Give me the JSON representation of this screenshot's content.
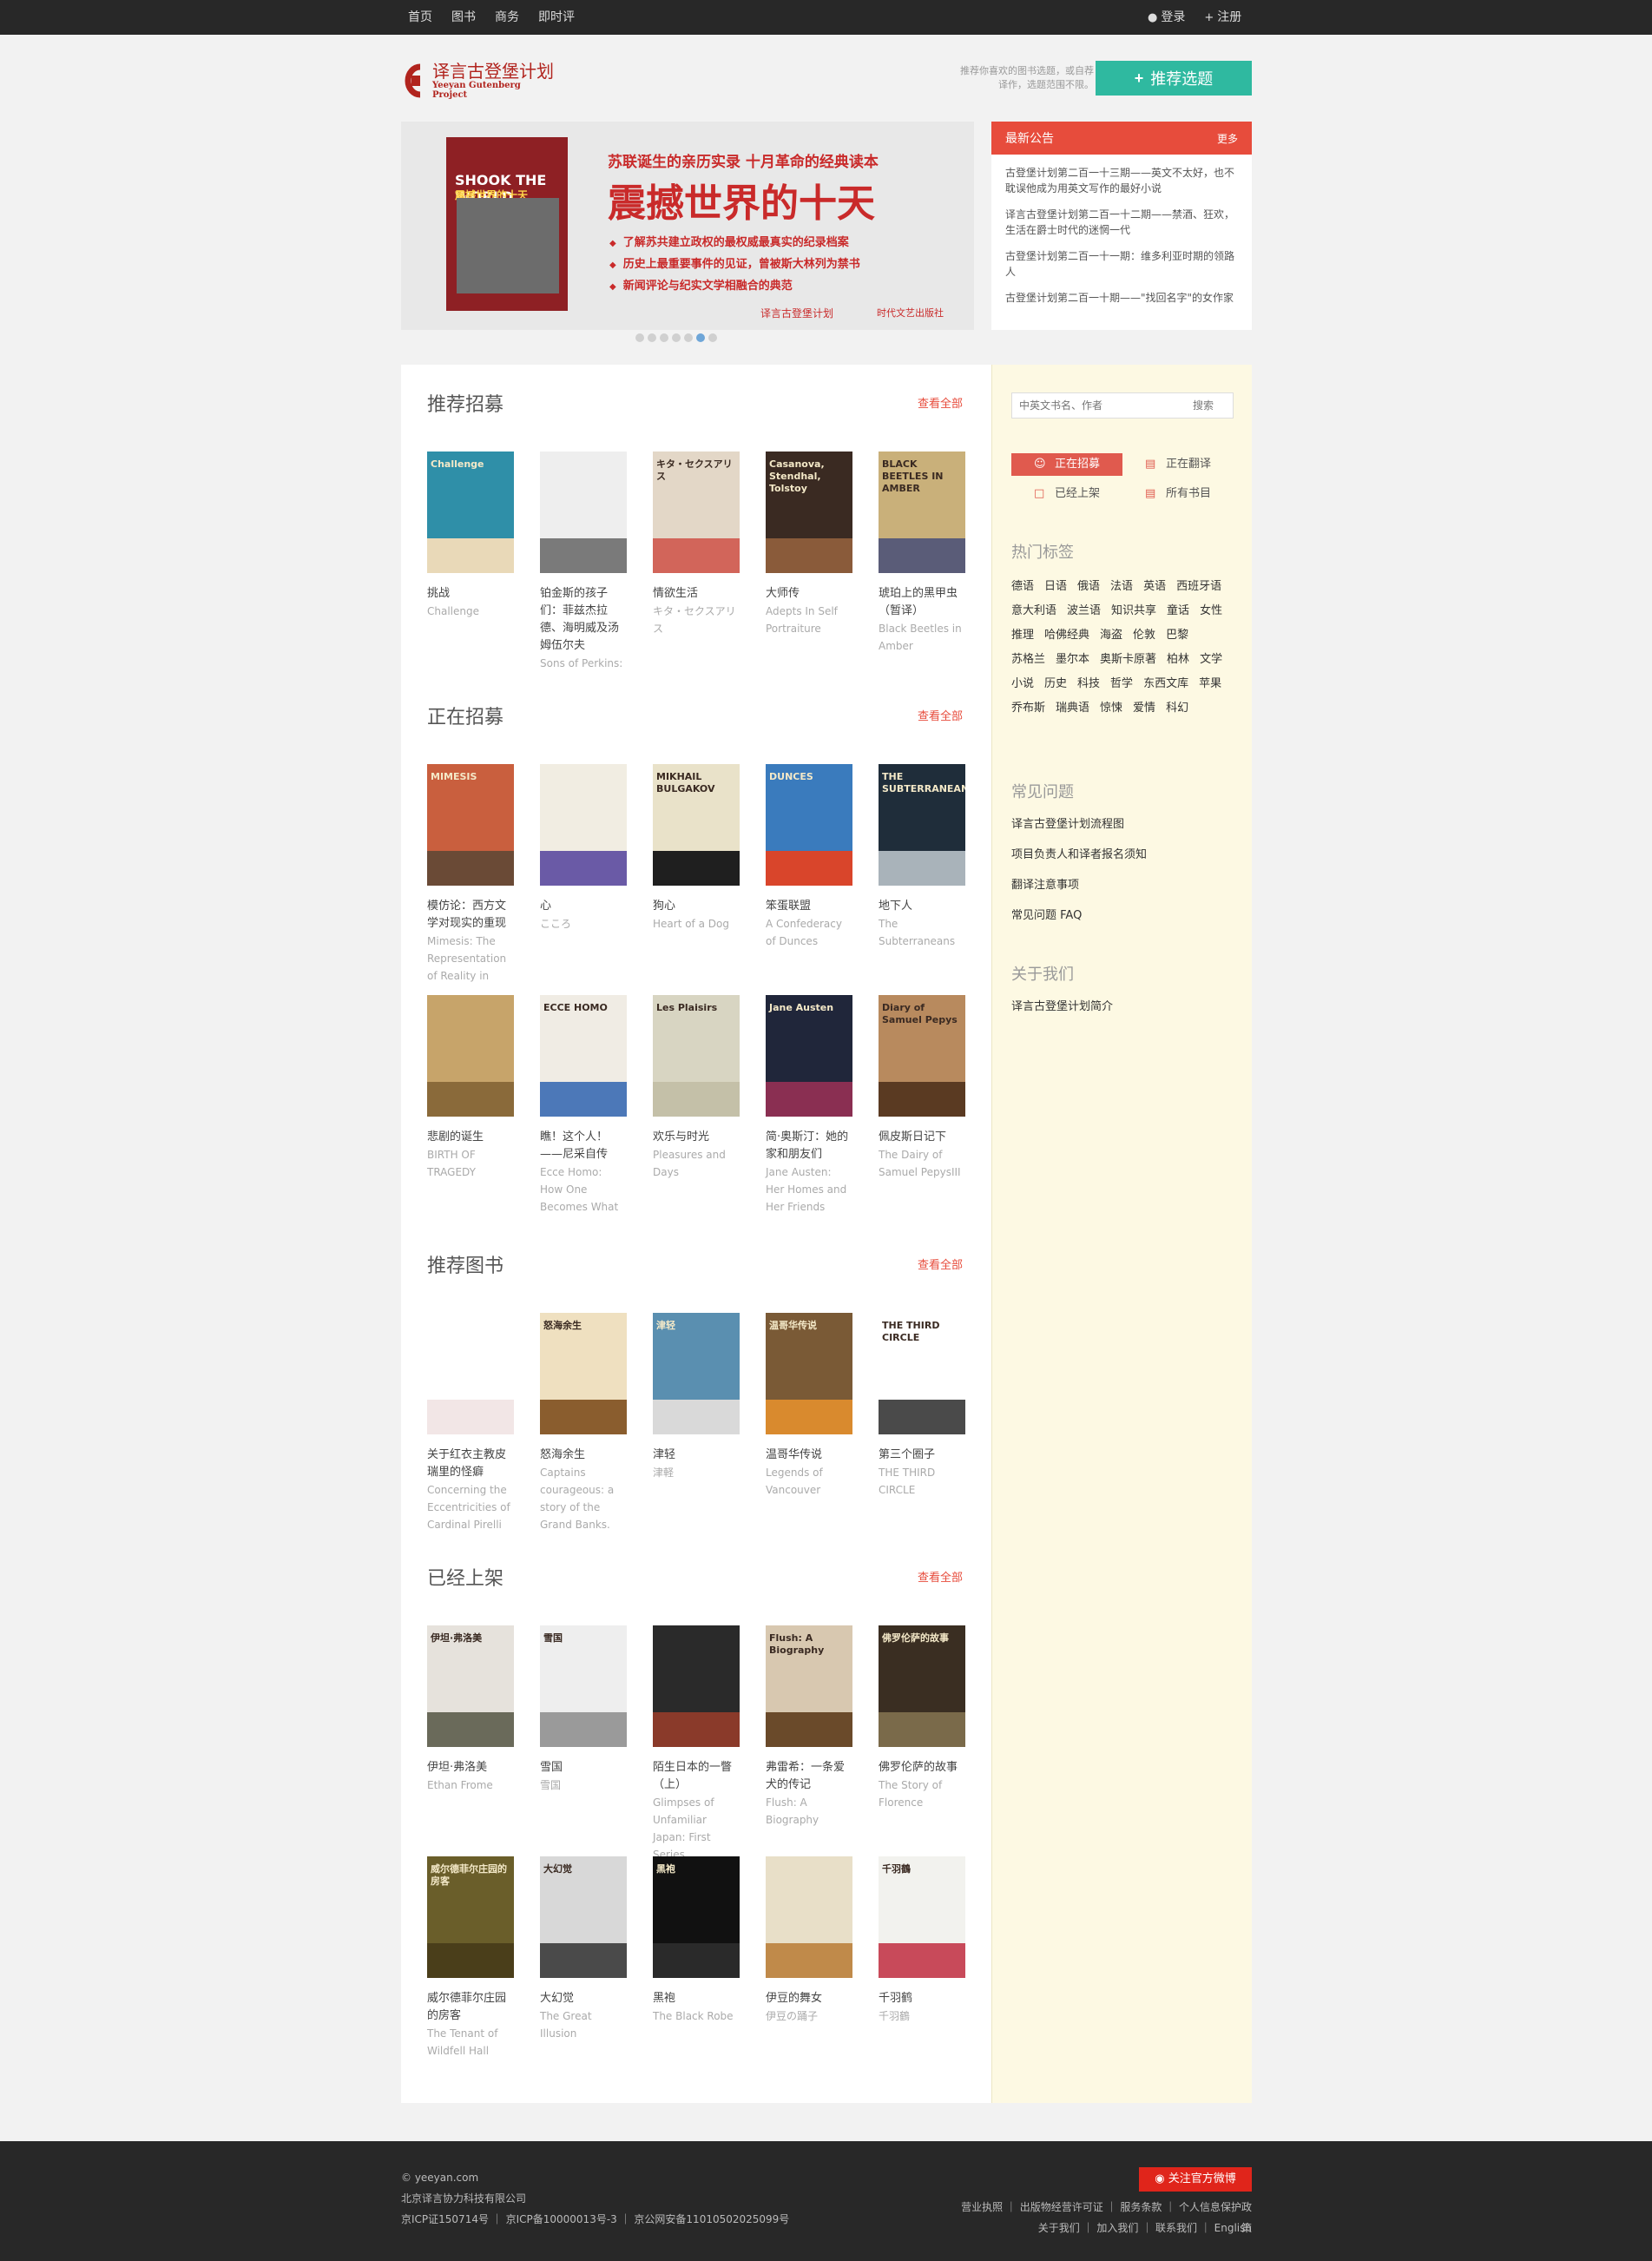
{
  "topnav": {
    "items": [
      "首页",
      "图书",
      "商务",
      "即时评"
    ]
  },
  "auth": {
    "login": "登录",
    "register": "注册"
  },
  "brand": {
    "name_cn": "译言古登堡计划",
    "name_en": "Yeeyan Gutenberg Project"
  },
  "header": {
    "note": "推荐你喜欢的图书选题，或自荐译作，选题范围不限。",
    "recommend_button": "推荐选题"
  },
  "banner": {
    "book_title_en": "SHOOK THE WORLD",
    "book_title_cn": "震撼世界的十天",
    "subtitle": "苏联诞生的亲历实录 十月革命的经典读本",
    "title": "震撼世界的十天",
    "bullets": [
      "了解苏共建立政权的最权威最真实的纪录档案",
      "历史上最重要事件的见证，曾被斯大林列为禁书",
      "新闻评论与纪实文学相融合的典范"
    ],
    "publisher1": "译言古登堡计划",
    "publisher2": "时代文艺出版社",
    "slides": 7,
    "active_slide": 6
  },
  "notice": {
    "title": "最新公告",
    "more": "更多",
    "items": [
      "古登堡计划第二百一十三期——英文不太好，也不耽误他成为用英文写作的最好小说",
      "译言古登堡计划第二百一十二期——禁酒、狂欢，生活在爵士时代的迷惘一代",
      "古登堡计划第二百一十一期：维多利亚时期的领路人",
      "古登堡计划第二百一十期——\"找回名字\"的女作家"
    ]
  },
  "sections": [
    {
      "title": "推荐招募",
      "more": "查看全部",
      "books": [
        {
          "cn": "挑战",
          "en": "Challenge",
          "color": "#2f8fa8",
          "band": "#e9d9b8",
          "label": "Challenge"
        },
        {
          "cn": "铂金斯的孩子们：菲兹杰拉德、海明威及汤姆伍尔夫",
          "en": "Sons of Perkins:",
          "color": "#eeeeee",
          "band": "#7a7a7a",
          "label": ""
        },
        {
          "cn": "情欲生活",
          "en": "キタ・セクスアリス",
          "color": "#e3d7c7",
          "band": "#d2655a",
          "label": "キタ・セクスアリス"
        },
        {
          "cn": "大师传",
          "en": "Adepts In Self Portraiture",
          "color": "#3a2a22",
          "band": "#8a5b3a",
          "label": "Casanova, Stendhal, Tolstoy"
        },
        {
          "cn": "琥珀上的黑甲虫（暂译）",
          "en": "Black Beetles in Amber",
          "color": "#c9b07a",
          "band": "#5a5c78",
          "label": "BLACK BEETLES IN AMBER"
        }
      ]
    },
    {
      "title": "正在招募",
      "more": "查看全部",
      "books": [
        {
          "cn": "模仿论：西方文学对现实的重现",
          "en": "Mimesis: The Representation of Reality in",
          "color": "#c95f3e",
          "band": "#6a4a36",
          "label": "MIMESIS"
        },
        {
          "cn": "心",
          "en": "こころ",
          "color": "#f1ede2",
          "band": "#6a5aa6",
          "label": ""
        },
        {
          "cn": "狗心",
          "en": "Heart of a Dog",
          "color": "#e9e2c9",
          "band": "#1f1f1f",
          "label": "MIKHAIL BULGAKOV"
        },
        {
          "cn": "笨蛋联盟",
          "en": "A Confederacy of Dunces",
          "color": "#3a7bbd",
          "band": "#d9452b",
          "label": "DUNCES"
        },
        {
          "cn": "地下人",
          "en": "The Subterraneans",
          "color": "#1f2d3a",
          "band": "#a9b3ba",
          "label": "THE SUBTERRANEANS"
        },
        {
          "cn": "悲剧的诞生",
          "en": "BIRTH OF TRAGEDY",
          "color": "#c7a46a",
          "band": "#8a6a3a",
          "label": ""
        },
        {
          "cn": "瞧！这个人！——尼采自传",
          "en": "Ecce Homo: How One Becomes What",
          "color": "#f0ece4",
          "band": "#4c78b8",
          "label": "ECCE HOMO"
        },
        {
          "cn": "欢乐与时光",
          "en": "Pleasures and Days",
          "color": "#d8d5c2",
          "band": "#c4c0a8",
          "label": "Les Plaisirs"
        },
        {
          "cn": "简·奥斯汀：她的家和朋友们",
          "en": "Jane Austen: Her Homes and Her Friends",
          "color": "#20263a",
          "band": "#8a2f52",
          "label": "Jane Austen"
        },
        {
          "cn": "佩皮斯日记下",
          "en": "The Dairy of Samuel PepysIII",
          "color": "#b88a5e",
          "band": "#5a3a22",
          "label": "Diary of Samuel Pepys"
        }
      ]
    },
    {
      "title": "推荐图书",
      "more": "查看全部",
      "books": [
        {
          "cn": "关于红衣主教皮瑞里的怪癖",
          "en": "Concerning the Eccentricities of Cardinal Pirelli",
          "color": "#ffffff",
          "band": "#f2e6e6",
          "label": ""
        },
        {
          "cn": "怒海余生",
          "en": "Captains courageous: a story of the Grand Banks.",
          "color": "#efe0c0",
          "band": "#8a5d2e",
          "label": "怒海余生"
        },
        {
          "cn": "津轻",
          "en": "津軽",
          "color": "#5a8fb0",
          "band": "#d9d9d9",
          "label": "津轻"
        },
        {
          "cn": "温哥华传说",
          "en": "Legends of Vancouver",
          "color": "#7a5a36",
          "band": "#d98a2e",
          "label": "温哥华传说"
        },
        {
          "cn": "第三个圈子",
          "en": "THE THIRD CIRCLE",
          "color": "#ffffff",
          "band": "#4a4a4a",
          "label": "THE THIRD CIRCLE"
        }
      ]
    },
    {
      "title": "已经上架",
      "more": "查看全部",
      "books": [
        {
          "cn": "伊坦·弗洛美",
          "en": "Ethan Frome",
          "color": "#e6e2dc",
          "band": "#6a6a5a",
          "label": "伊坦·弗洛美"
        },
        {
          "cn": "雪国",
          "en": "雪国",
          "color": "#eeeeee",
          "band": "#9a9a9a",
          "label": "雪国"
        },
        {
          "cn": "陌生日本的一瞥（上）",
          "en": "Glimpses of Unfamiliar Japan: First Series",
          "color": "#2a2a2a",
          "band": "#8a3a2a",
          "label": ""
        },
        {
          "cn": "弗雷希：一条爱犬的传记",
          "en": "Flush: A Biography",
          "color": "#d8c8b0",
          "band": "#6a4a2a",
          "label": "Flush: A Biography"
        },
        {
          "cn": "佛罗伦萨的故事",
          "en": "The Story of Florence",
          "color": "#3a2e22",
          "band": "#7a6a4a",
          "label": "佛罗伦萨的故事"
        },
        {
          "cn": "威尔德菲尔庄园的房客",
          "en": "The Tenant of Wildfell Hall",
          "color": "#6a5e2a",
          "band": "#4a3e1a",
          "label": "威尔德菲尔庄园的房客"
        },
        {
          "cn": "大幻觉",
          "en": "The Great Illusion",
          "color": "#d8d8d8",
          "band": "#4a4a4a",
          "label": "大幻觉"
        },
        {
          "cn": "黑袍",
          "en": "The Black Robe",
          "color": "#111111",
          "band": "#2a2a2a",
          "label": "黑袍"
        },
        {
          "cn": "伊豆的舞女",
          "en": "伊豆の踊子",
          "color": "#e8dfc8",
          "band": "#c08a4a",
          "label": ""
        },
        {
          "cn": "千羽鹤",
          "en": "千羽鶴",
          "color": "#f2f2ee",
          "band": "#c84a5a",
          "label": "千羽鶴"
        }
      ]
    }
  ],
  "sidebar": {
    "search_placeholder": "中英文书名、作者",
    "search_button": "搜索",
    "status": [
      "正在招募",
      "正在翻译",
      "已经上架",
      "所有书目"
    ],
    "tags_title": "热门标签",
    "tags": [
      "德语",
      "日语",
      "俄语",
      "法语",
      "英语",
      "西班牙语",
      "意大利语",
      "波兰语",
      "知识共享",
      "童话",
      "女性",
      "推理",
      "哈佛经典",
      "海盗",
      "伦敦",
      "巴黎",
      "苏格兰",
      "墨尔本",
      "奥斯卡原著",
      "柏林",
      "文学",
      "小说",
      "历史",
      "科技",
      "哲学",
      "东西文库",
      "苹果",
      "乔布斯",
      "瑞典语",
      "惊悚",
      "爱情",
      "科幻"
    ],
    "faq_title": "常见问题",
    "faq": [
      "译言古登堡计划流程图",
      "项目负责人和译者报名须知",
      "翻译注意事项",
      "常见问题 FAQ"
    ],
    "about_title": "关于我们",
    "about": [
      "译言古登堡计划简介"
    ]
  },
  "footer": {
    "copyright": "© yeeyan.com",
    "company": "北京译言协力科技有限公司",
    "icp": "京ICP证150714号 ｜ 京ICP备10000013号-3 ｜ 京公网安备11010502025099号",
    "weibo": "关注官方微博",
    "links1": "营业执照 ｜ 出版物经营许可证 ｜ 服务条款 ｜ 个人信息保护政策",
    "links2": "关于我们 ｜ 加入我们 ｜ 联系我们 ｜ English"
  },
  "colors": {
    "accent": "#e74c3c",
    "teal": "#2fb9a0",
    "dark": "#282828",
    "sidebar": "#fdf9e3"
  }
}
